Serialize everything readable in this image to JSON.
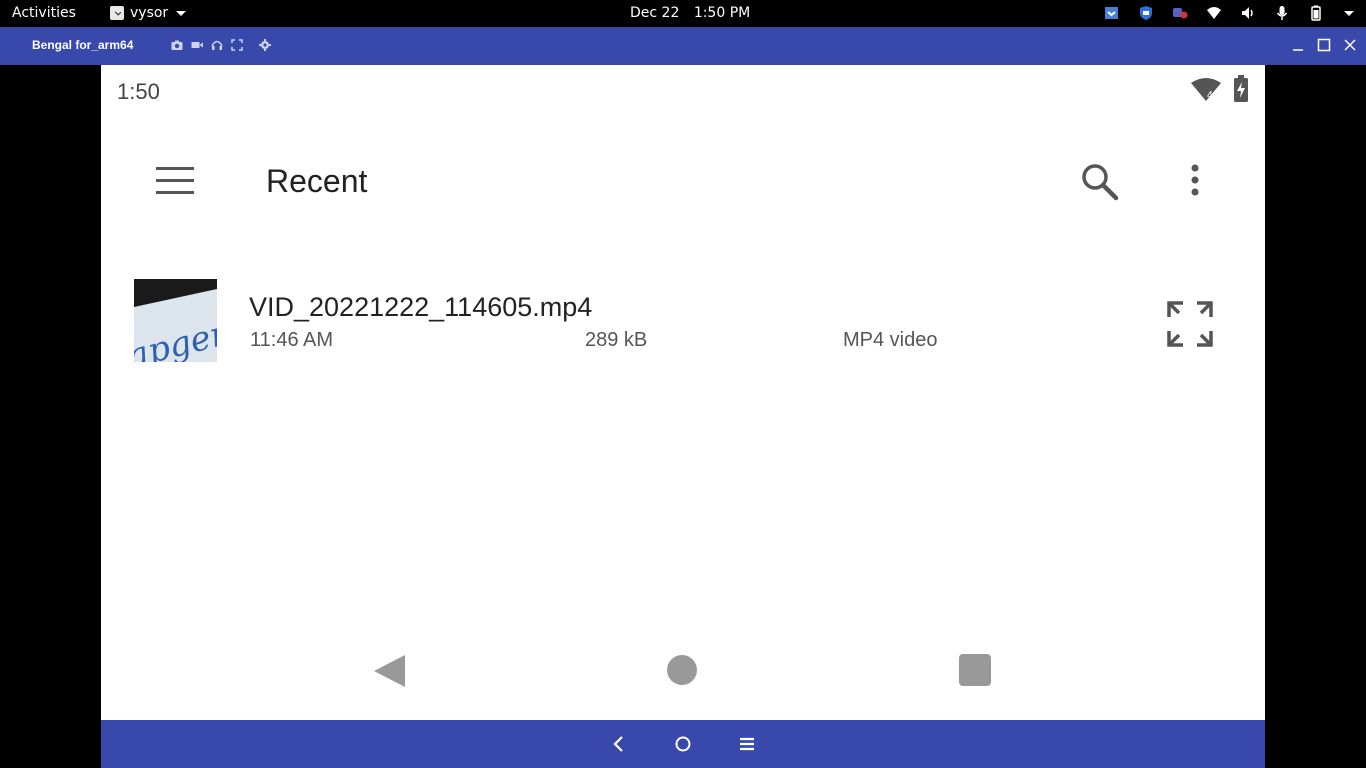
{
  "system_bar": {
    "activities": "Activities",
    "app_name": "vysor",
    "date": "Dec 22",
    "time": "1:50 PM"
  },
  "window": {
    "title": "Bengal for_arm64",
    "accent_color": "#3949ab"
  },
  "android": {
    "status_time": "1:50",
    "wifi_badge": "4",
    "app_bar": {
      "title": "Recent"
    },
    "files": [
      {
        "name": "VID_20221222_114605.mp4",
        "time": "11:46 AM",
        "size": "289 kB",
        "type": "MP4 video",
        "thumb_text": "apger"
      }
    ]
  }
}
